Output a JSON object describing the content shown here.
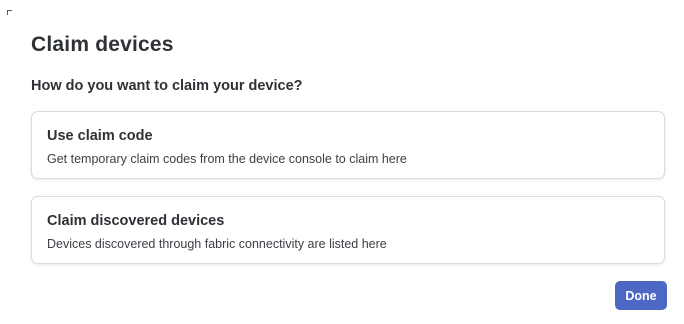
{
  "dialog": {
    "title": "Claim devices",
    "question": "How do you want to claim your device?"
  },
  "options": [
    {
      "title": "Use claim code",
      "description": "Get temporary claim codes from the device console to claim here"
    },
    {
      "title": "Claim discovered devices",
      "description": "Devices discovered through fabric connectivity are listed here"
    }
  ],
  "actions": {
    "done_label": "Done"
  },
  "colors": {
    "primary_button": "#4c67c4",
    "card_border": "#dcdde0",
    "text": "#2e3135"
  }
}
